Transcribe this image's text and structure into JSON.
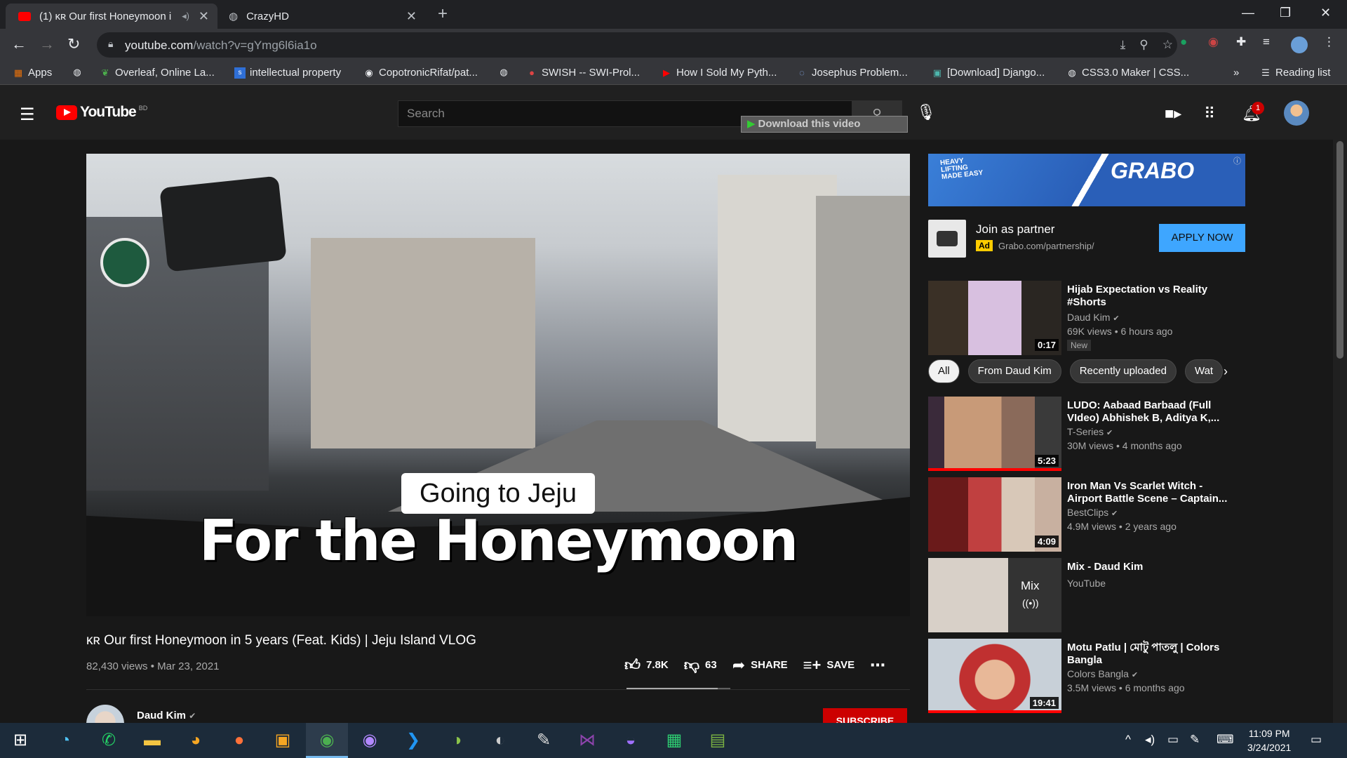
{
  "browser": {
    "tabs": [
      {
        "label": "(1) ĸʀ Our first Honeymoon i",
        "active": true
      },
      {
        "label": "CrazyHD",
        "active": false
      }
    ],
    "url_host": "youtube.com",
    "url_path": "/watch?v=gYmg6l6ia1o",
    "bookmarks": [
      "Apps",
      "Overleaf, Online La...",
      "intellectual property",
      "CopotronicRifat/pat...",
      "SWISH -- SWI-Prol...",
      "How I Sold My Pyth...",
      "Josephus Problem...",
      "[Download] Django...",
      "CSS3.0 Maker | CSS...",
      "»",
      "Reading list"
    ]
  },
  "youtube": {
    "logo": "YouTube",
    "country": "BD",
    "search_placeholder": "Search",
    "download_label": "Download this video",
    "notif_count": "1"
  },
  "video": {
    "subtitle1": "Going to Jeju",
    "subtitle2": "For the Honeymoon",
    "title": "ĸʀ Our first Honeymoon in 5 years (Feat. Kids) | Jeju Island VLOG",
    "meta": "82,430 views • Mar 23, 2021",
    "likes": "7.8K",
    "dislikes": "63",
    "share": "SHARE",
    "save": "SAVE",
    "like_ratio": 0.88,
    "channel": "Daud Kim",
    "subscribe": "SUBSCRIBE"
  },
  "ad": {
    "banner_brand": "GRABO",
    "banner_slogan": "HEAVY LIFTING MADE EASY",
    "title": "Join as partner",
    "tag": "Ad",
    "url": "Grabo.com/partnership/",
    "cta": "APPLY NOW"
  },
  "chips": [
    "All",
    "From Daud Kim",
    "Recently uploaded",
    "Wat"
  ],
  "recs": [
    {
      "title": "Hijab Expectation vs Reality #Shorts",
      "channel": "Daud Kim",
      "views": "69K views • 6 hours ago",
      "duration": "0:17",
      "badge": "New"
    },
    {
      "title": "LUDO: Aabaad Barbaad (Full VIdeo) Abhishek B, Aditya K,...",
      "channel": "T-Series",
      "views": "30M views • 4 months ago",
      "duration": "5:23"
    },
    {
      "title": "Iron Man Vs Scarlet Witch - Airport Battle Scene – Captain...",
      "channel": "BestClips",
      "views": "4.9M views • 2 years ago",
      "duration": "4:09"
    },
    {
      "title": "Mix - Daud Kim",
      "channel": "YouTube",
      "views": "",
      "duration": "Mix"
    },
    {
      "title": "Motu Patlu | মোটু পাতলু | Colors Bangla",
      "channel": "Colors Bangla",
      "views": "3.5M views • 6 months ago",
      "duration": "19:41"
    }
  ],
  "taskbar": {
    "time": "11:09 PM",
    "date": "3/24/2021"
  }
}
